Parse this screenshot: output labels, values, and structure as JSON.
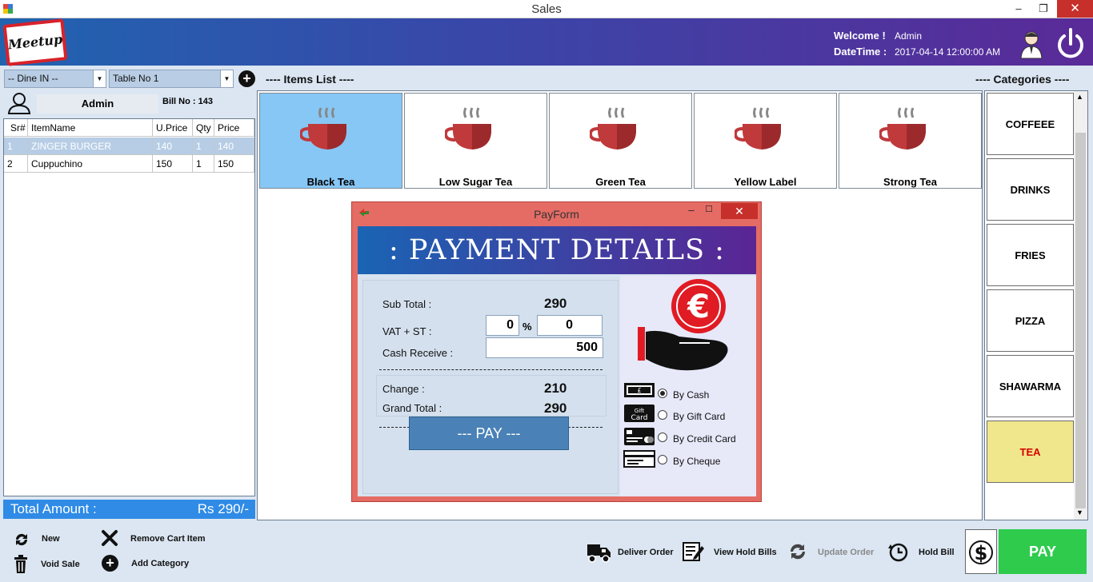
{
  "window": {
    "title": "Sales",
    "minimize": "–",
    "maximize": "❐",
    "close": "✕"
  },
  "header": {
    "logo_text": "Meetup",
    "welcome_label": "Welcome !",
    "welcome_user": "Admin",
    "datetime_label": "DateTime :",
    "datetime_value": "2017-04-14 12:00:00 AM"
  },
  "order": {
    "mode_selected": "-- Dine IN --",
    "table_selected": "Table No 1",
    "user_name": "Admin",
    "bill_no": "Bill No : 143"
  },
  "cart": {
    "columns": [
      "Sr#",
      "ItemName",
      "U.Price",
      "Qty",
      "Price"
    ],
    "rows": [
      [
        "1",
        "ZINGER BURGER",
        "140",
        "1",
        "140"
      ],
      [
        "2",
        "Cuppuchino",
        "150",
        "1",
        "150"
      ]
    ],
    "selected_row": 0,
    "total_label": "Total Amount :",
    "total_value": "Rs 290/-"
  },
  "items": {
    "title": "---- Items List ----",
    "list": [
      "Black Tea",
      "Low Sugar Tea",
      "Green Tea",
      "Yellow Label",
      "Strong Tea"
    ],
    "active_index": 0
  },
  "categories": {
    "title": "---- Categories ----",
    "list": [
      "COFFEEE",
      "DRINKS",
      "FRIES",
      "PIZZA",
      "SHAWARMA",
      "TEA"
    ],
    "active_index": 5
  },
  "payform": {
    "title": "PayForm",
    "banner": ": PAYMENT DETAILS :",
    "subtotal_label": "Sub Total :",
    "subtotal_value": "290",
    "vat_label": "VAT + ST :",
    "vat_percent": "0",
    "percent_sign": "%",
    "vat_amount": "0",
    "cash_label": "Cash Receive :",
    "cash_value": "500",
    "change_label": "Change :",
    "change_value": "210",
    "grand_label": "Grand Total :",
    "grand_value": "290",
    "pay_button": "--- PAY ---",
    "methods": [
      "By Cash",
      "By Gift Card",
      "By Credit Card",
      "By Cheque"
    ],
    "selected_method": 0,
    "gift_icon_text": "Gift Card"
  },
  "toolbar": {
    "new": "New",
    "void_sale": "Void Sale",
    "remove_cart_item": "Remove Cart Item",
    "add_category": "Add Category",
    "deliver_order": "Deliver Order",
    "view_hold_bills": "View Hold Bills",
    "update_order": "Update Order",
    "hold_bill": "Hold Bill",
    "pay": "PAY"
  },
  "colors": {
    "header_start": "#2064b0",
    "header_end": "#5a2a98",
    "active_item": "#87c7f5",
    "active_category": "#f0e68c",
    "pay_green": "#2ecb4d",
    "total_bar": "#2f8be6"
  }
}
